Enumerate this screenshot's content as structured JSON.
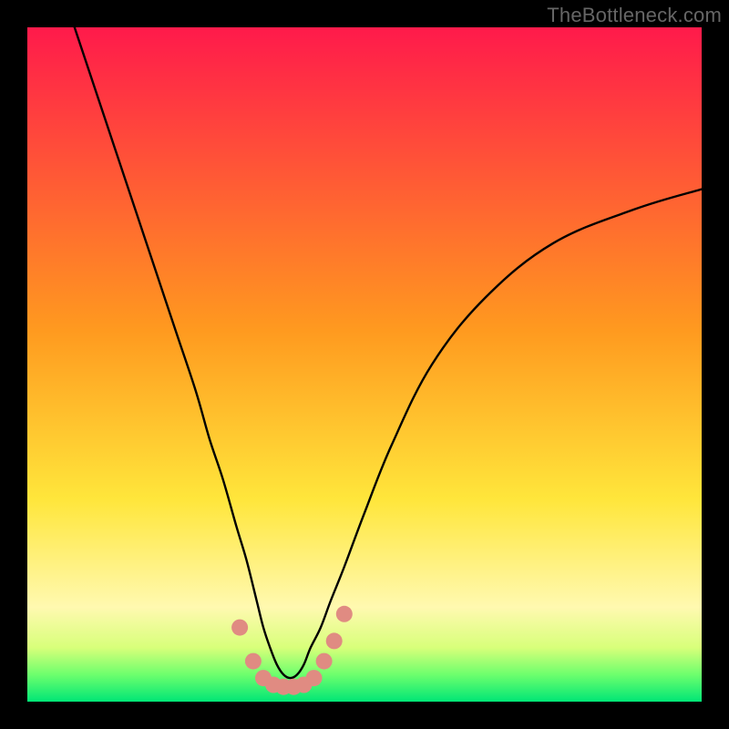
{
  "watermark": "TheBottleneck.com",
  "chart_data": {
    "type": "line",
    "title": "",
    "xlabel": "",
    "ylabel": "",
    "xlim": [
      0,
      100
    ],
    "ylim": [
      0,
      100
    ],
    "background_gradient": {
      "stops": [
        {
          "offset": 0.0,
          "color": "#ff1a4b"
        },
        {
          "offset": 0.45,
          "color": "#ff9a1f"
        },
        {
          "offset": 0.7,
          "color": "#ffe63b"
        },
        {
          "offset": 0.86,
          "color": "#fff9b0"
        },
        {
          "offset": 0.92,
          "color": "#d8ff7a"
        },
        {
          "offset": 0.96,
          "color": "#6dff6d"
        },
        {
          "offset": 1.0,
          "color": "#00e676"
        }
      ]
    },
    "series": [
      {
        "name": "curve",
        "type": "line",
        "color": "#000000",
        "x": [
          7,
          10,
          13,
          16,
          19,
          22,
          25,
          27,
          29,
          31,
          32.5,
          34,
          35,
          36,
          37,
          38,
          39,
          40,
          41,
          42,
          43.5,
          45,
          47,
          50,
          54,
          60,
          68,
          78,
          90,
          100
        ],
        "y": [
          100,
          91,
          82,
          73,
          64,
          55,
          46,
          39,
          33,
          26,
          21,
          15,
          11,
          8,
          5.5,
          4,
          3.5,
          4,
          5.5,
          8,
          11,
          15,
          20,
          28,
          38,
          50,
          60,
          68,
          73,
          76
        ]
      },
      {
        "name": "highlight-points",
        "type": "scatter",
        "color": "#e08b82",
        "x": [
          31.5,
          33.5,
          35,
          36.5,
          38,
          39.5,
          41,
          42.5,
          44,
          45.5,
          47
        ],
        "y": [
          11,
          6,
          3.5,
          2.5,
          2.2,
          2.2,
          2.5,
          3.5,
          6,
          9,
          13
        ]
      }
    ]
  }
}
